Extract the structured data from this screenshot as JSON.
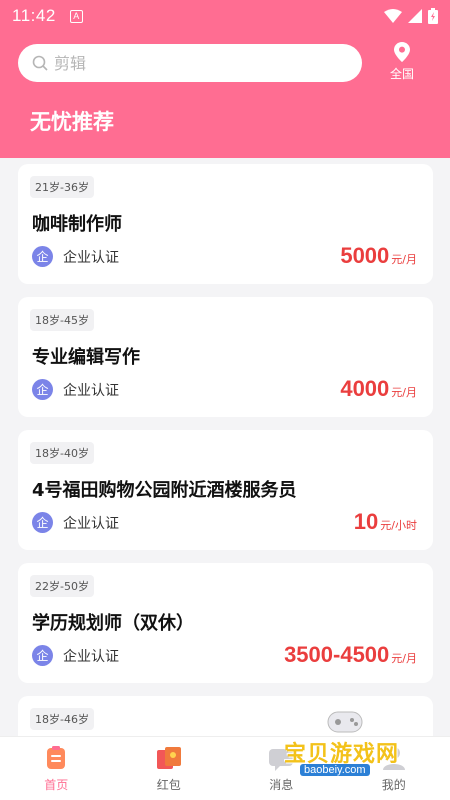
{
  "status": {
    "time": "11:42",
    "app_indicator": "A"
  },
  "search": {
    "placeholder": "剪辑",
    "value": ""
  },
  "location": {
    "label": "全国"
  },
  "section_title": "无忧推荐",
  "jobs": [
    {
      "age": "21岁-36岁",
      "title": "咖啡制作师",
      "cert_badge": "企",
      "cert_label": "企业认证",
      "salary": "5000",
      "unit": "元/月"
    },
    {
      "age": "18岁-45岁",
      "title": "专业编辑写作",
      "cert_badge": "企",
      "cert_label": "企业认证",
      "salary": "4000",
      "unit": "元/月"
    },
    {
      "age": "18岁-40岁",
      "title": "4号福田购物公园附近酒楼服务员",
      "cert_badge": "企",
      "cert_label": "企业认证",
      "salary": "10",
      "unit": "元/小时"
    },
    {
      "age": "22岁-50岁",
      "title": "学历规划师（双休）",
      "cert_badge": "企",
      "cert_label": "企业认证",
      "salary": "3500-4500",
      "unit": "元/月"
    },
    {
      "age": "18岁-46岁"
    }
  ],
  "tabs": [
    {
      "label": "首页",
      "icon": "home-icon",
      "active": true
    },
    {
      "label": "红包",
      "icon": "red-packet-icon",
      "active": false
    },
    {
      "label": "消息",
      "icon": "message-icon",
      "active": false
    },
    {
      "label": "我的",
      "icon": "profile-icon",
      "active": false
    }
  ],
  "watermark": {
    "text": "宝贝游戏网",
    "url": "baobeiy.com"
  },
  "colors": {
    "brand": "#ff6d92",
    "salary": "#ea3e3e",
    "cert": "#7b84e8"
  }
}
